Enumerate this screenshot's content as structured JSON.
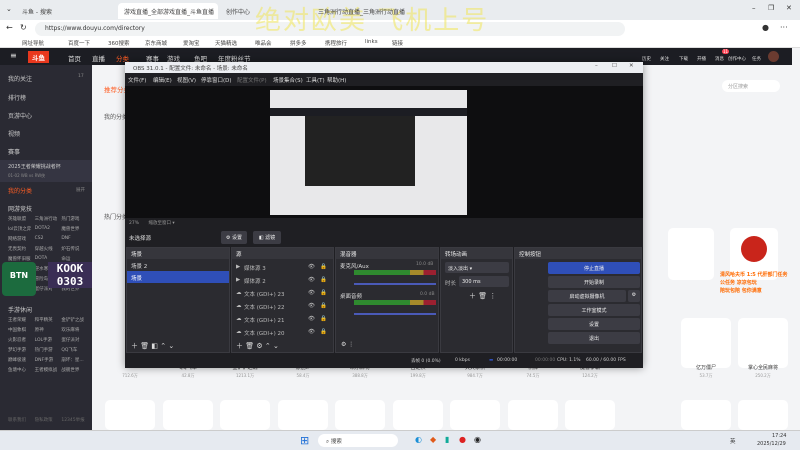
{
  "browser": {
    "tabs": [
      "斗鱼 - 搜索",
      "游戏直播_全部游戏直播_斗鱼直播",
      "创作中心",
      "三角洲行动直播_三角洲行动直播"
    ],
    "url": "https://www.douyu.com/directory",
    "bookmarks": [
      "网址导航",
      "百度一下",
      "360搜索",
      "京东商城",
      "爱淘宝",
      "天猫精选",
      "唯品会",
      "拼多多",
      "携程旅行",
      "links",
      "链接"
    ]
  },
  "watermark": "绝对欧美 飞机上号",
  "douyu": {
    "logo": "斗鱼",
    "nav": [
      "首页",
      "直播",
      "分类",
      "赛事",
      "游戏",
      "鱼吧",
      "年度粉丝节"
    ],
    "right_nav": [
      "历史",
      "关注",
      "下载",
      "开播",
      "消息",
      "创作中心",
      "任务"
    ],
    "message_badge": "11",
    "search_placeholder": "分区搜索",
    "tab_recommend": "推荐分类",
    "my_category_heading": "我的分类",
    "hot_heading": "热门分类",
    "sidebar": {
      "items": [
        "我的关注",
        "排行榜",
        "页游中心",
        "视频",
        "赛事"
      ],
      "follow_count": "17",
      "event_title": "2025王者荣耀挑战者杯",
      "event_sub": "01-02 WB vs RW侠",
      "my_category": "我的分类",
      "expand": "展开",
      "section1": "网游竞技",
      "grid1": [
        "英雄联盟",
        "三角洲行动",
        "热门游戏",
        "lol云顶之弈",
        "DOTA2",
        "魔兽世界",
        "网络游戏",
        "CS2",
        "DNF",
        "无畏契约",
        "穿越火线",
        "炉石传说",
        "魔兽怀旧服",
        "DOTA",
        "命运",
        "永劫无间",
        "逆水寒",
        "剑网3",
        "传奇",
        "冒险岛",
        "暗黑破坏神",
        "坦克世界",
        "蛋仔派对",
        "我的世界"
      ],
      "section2": "手游休闲",
      "grid2": [
        "王者荣耀",
        "和平精英",
        "金铲铲之战",
        "中国象棋",
        "原神",
        "欢乐麻将",
        "火影忍者",
        "LOL手游",
        "蛋仔派对",
        "梦幻手游",
        "热门手游",
        "QQ飞车",
        "巅峰极速",
        "DNF手游",
        "崩坏：星...",
        "鱼塘中心",
        "王者模拟战",
        "战舰世界"
      ],
      "footer": [
        "联系我们",
        "隐私政策",
        "12345举报"
      ]
    },
    "overlay_logo": "BTN esports",
    "overlay_code": "KOOK 0303",
    "promo": [
      "清风哈夫币 1:5 代肝部门任务",
      "公任务  凉凉包玩",
      "陪玩包陪 包你满意"
    ],
    "cards": [
      {
        "name": "DNF",
        "count": "712.6万"
      },
      {
        "name": "QQ飞车",
        "count": "42.8万"
      },
      {
        "name": "金铲铲之战",
        "count": "1213.1万"
      },
      {
        "name": "原创IP",
        "count": "58.4万"
      },
      {
        "name": "欢乐麻将",
        "count": "388.8万"
      },
      {
        "name": "自走棋",
        "count": "199.8万"
      },
      {
        "name": "天天象棋",
        "count": "984.7万"
      },
      {
        "name": "棋牌",
        "count": "74.5万"
      },
      {
        "name": "魔兽争霸",
        "count": "124.2万"
      },
      {
        "name": "亿万僵尸",
        "count": "53.7万"
      },
      {
        "name": "掌心全民麻将",
        "count": "250.2万"
      }
    ]
  },
  "obs": {
    "title": "OBS 31.0.1 - 配置文件: 未命名 - 场景: 未命名",
    "menu": [
      "文件(F)",
      "编辑(E)",
      "视图(V)",
      "停靠窗口(D)",
      "配置文件(P)",
      "场景集合(S)",
      "工具(T)",
      "帮助(H)"
    ],
    "zoom": "27%",
    "zoom_label": "缩放至窗口",
    "no_source": "未选择源",
    "props": "设置",
    "filters": "滤镜",
    "scenes_title": "场景",
    "scenes": [
      "场景 2",
      "场景"
    ],
    "sources_title": "源",
    "sources": [
      "媒体源 3",
      "媒体源 2",
      "文本 (GDI+) 23",
      "文本 (GDI+) 22",
      "文本 (GDI+) 21",
      "文本 (GDI+) 20"
    ],
    "mixer_title": "混音器",
    "mic": "麦克风/Aux",
    "mic_db": "10.0 dB",
    "desktop": "桌面音频",
    "desktop_db": "0.0 dB",
    "trans_title": "转场动画",
    "transition": "淡入淡出",
    "duration_label": "时长",
    "duration": "300 ms",
    "controls_title": "控制按钮",
    "controls": [
      "停止直播",
      "开始录制",
      "启动虚拟摄像机",
      "工作室模式",
      "设置",
      "退出"
    ],
    "status": {
      "dropped": "丢帧 0 (0.0%)",
      "kbps": "0 kbps",
      "stream_time": "00:00:00",
      "rec_time": "00:00:00",
      "cpu": "CPU: 1.1%",
      "fps": "60.00 / 60.00 FPS"
    },
    "accent": "#2f4fb8"
  },
  "taskbar": {
    "search": "搜索",
    "ime": "英",
    "time": "17:24",
    "date": "2025/12/29"
  }
}
